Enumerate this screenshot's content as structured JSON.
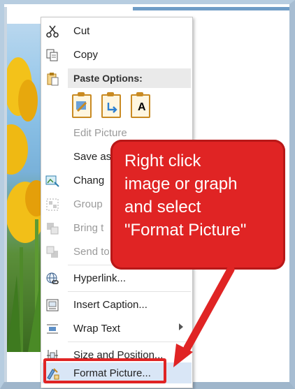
{
  "menu": {
    "cut": "Cut",
    "copy": "Copy",
    "paste_options_header": "Paste Options:",
    "paste_option_keep_text": "A",
    "edit_picture": "Edit Picture",
    "save_as": "Save as",
    "change": "Chang",
    "group": "Group",
    "bring": "Bring t",
    "send": "Send to",
    "hyperlink": "Hyperlink...",
    "insert_caption": "Insert Caption...",
    "wrap_text": "Wrap Text",
    "size_position": "Size and Position...",
    "format_picture": "Format Picture..."
  },
  "callout": {
    "line1": "Right click",
    "line2": "image or graph",
    "line3": "and select",
    "line4": "\"Format Picture\""
  },
  "colors": {
    "accent_red": "#e02424",
    "menu_highlight": "#d9e6f6"
  }
}
